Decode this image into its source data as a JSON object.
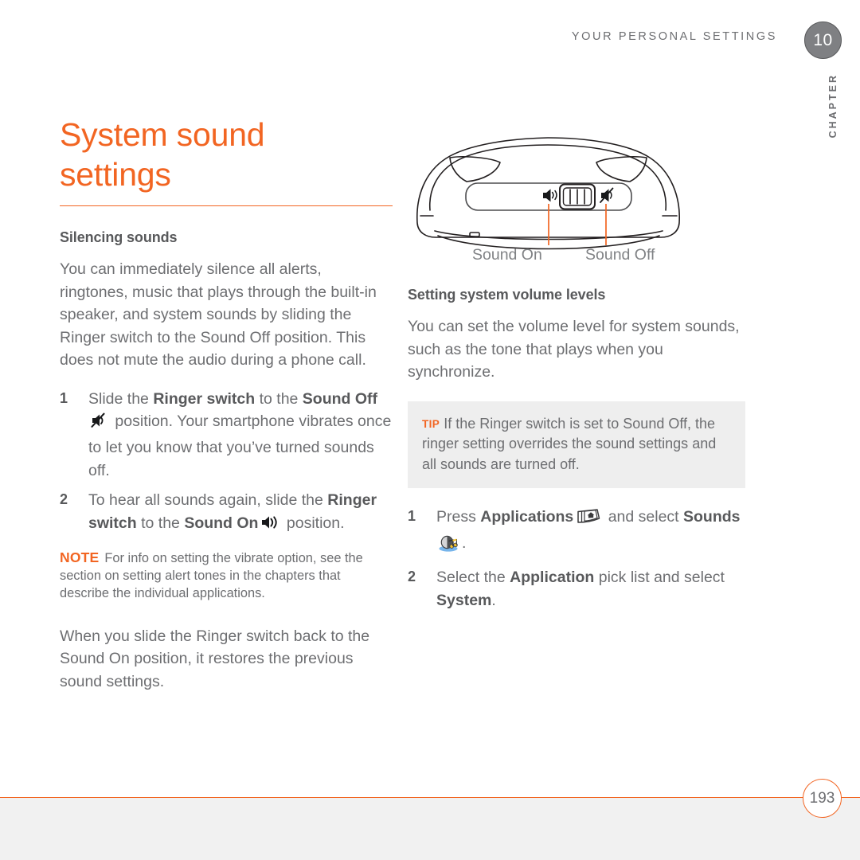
{
  "header": {
    "running_head": "YOUR PERSONAL SETTINGS",
    "chapter_number": "10",
    "chapter_word": "CHAPTER"
  },
  "colors": {
    "accent": "#f26522",
    "body_text": "#6d6e71",
    "heading": "#58595b",
    "tip_background": "#eeeeee",
    "footer_band": "#f1f1f1",
    "chapter_badge": "#7f8083"
  },
  "left_column": {
    "title": "System sound settings",
    "section_heading": "Silencing sounds",
    "intro_paragraph": "You can immediately silence all alerts, ringtones, music that plays through the built-in speaker, and system sounds by sliding the Ringer switch to the Sound Off position. This does not mute the audio during a phone call.",
    "steps": [
      {
        "number": "1",
        "parts": [
          {
            "text": "Slide the ",
            "style": "normal"
          },
          {
            "text": "Ringer switch",
            "style": "bold"
          },
          {
            "text": " to the ",
            "style": "normal"
          },
          {
            "text": "Sound Off",
            "style": "bold"
          },
          {
            "icon": "sound-off-icon"
          },
          {
            "text": " position. Your smartphone vibrates once to let you know that you’ve turned sounds off.",
            "style": "normal"
          }
        ]
      },
      {
        "number": "2",
        "parts": [
          {
            "text": "To hear all sounds again, slide the ",
            "style": "normal"
          },
          {
            "text": "Ringer switch",
            "style": "bold"
          },
          {
            "text": " to the ",
            "style": "normal"
          },
          {
            "text": "Sound On",
            "style": "bold"
          },
          {
            "icon": "sound-on-icon"
          },
          {
            "text": " position.",
            "style": "normal"
          }
        ]
      }
    ],
    "note": {
      "label": "NOTE",
      "text": "For info on setting the vibrate option, see the section on setting alert tones in the chapters that describe the individual applications."
    },
    "closing_paragraph": "When you slide the Ringer switch back to the Sound On position, it restores the previous sound settings."
  },
  "figure": {
    "name": "smartphone-ringer-switch-illustration",
    "callouts": [
      {
        "label": "Sound On",
        "points_to": "speaker-on-icon"
      },
      {
        "label": "Sound Off",
        "points_to": "speaker-muted-icon"
      }
    ],
    "switch_icons": [
      "speaker-on-icon",
      "ringer-slider",
      "speaker-muted-icon"
    ]
  },
  "right_column": {
    "section_heading": "Setting system volume levels",
    "intro_paragraph": "You can set the volume level for system sounds, such as the tone that plays when you synchronize.",
    "tip": {
      "label": "TIP",
      "text": "If the Ringer switch is set to Sound Off, the ringer setting overrides the sound settings and all sounds are turned off."
    },
    "steps": [
      {
        "number": "1",
        "parts": [
          {
            "text": "Press ",
            "style": "normal"
          },
          {
            "text": "Applications",
            "style": "bold"
          },
          {
            "icon": "applications-key-icon"
          },
          {
            "text": " and select ",
            "style": "normal"
          },
          {
            "text": "Sounds",
            "style": "bold"
          },
          {
            "icon": "sounds-app-icon"
          },
          {
            "text": ".",
            "style": "normal"
          }
        ]
      },
      {
        "number": "2",
        "parts": [
          {
            "text": "Select the ",
            "style": "normal"
          },
          {
            "text": "Application",
            "style": "bold"
          },
          {
            "text": " pick list and select ",
            "style": "normal"
          },
          {
            "text": "System",
            "style": "bold"
          },
          {
            "text": ".",
            "style": "normal"
          }
        ]
      }
    ]
  },
  "footer": {
    "page_number": "193"
  }
}
